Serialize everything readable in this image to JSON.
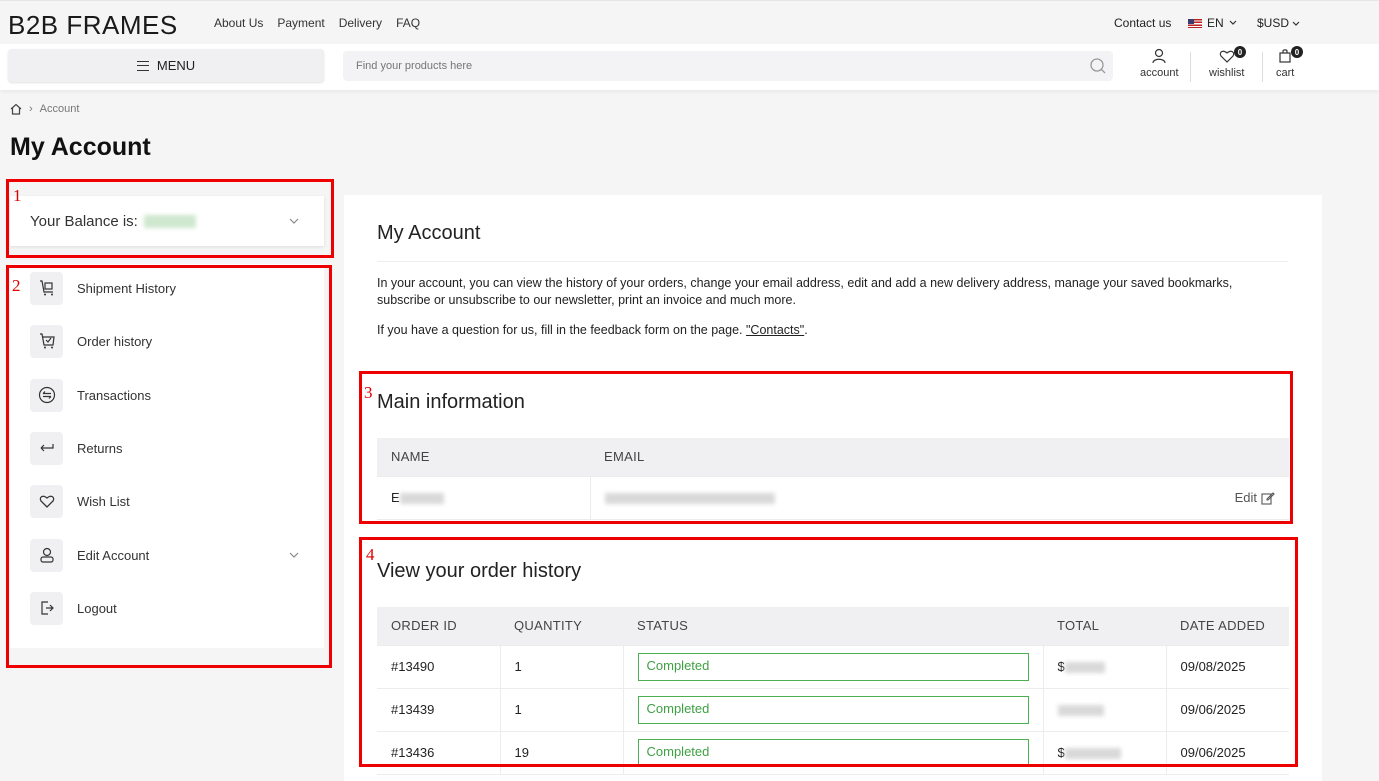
{
  "topbar": {
    "logo": "B2B FRAMES",
    "nav": [
      "About Us",
      "Payment",
      "Delivery",
      "FAQ"
    ],
    "contact": "Contact us",
    "language": "EN",
    "currency": "$USD"
  },
  "header": {
    "menu_label": "MENU",
    "search_placeholder": "Find your products here",
    "account_label": "account",
    "wishlist_label": "wishlist",
    "wishlist_count": "0",
    "cart_label": "cart",
    "cart_count": "0"
  },
  "breadcrumb": {
    "current": "Account"
  },
  "page_title": "My Account",
  "sidebar": {
    "balance_label": "Your Balance is:",
    "items": [
      {
        "label": "Shipment History",
        "icon": "cart-box-icon"
      },
      {
        "label": "Order history",
        "icon": "cart-check-icon"
      },
      {
        "label": "Transactions",
        "icon": "exchange-icon"
      },
      {
        "label": "Returns",
        "icon": "return-arrow-icon"
      },
      {
        "label": "Wish List",
        "icon": "heart-icon"
      },
      {
        "label": "Edit Account",
        "icon": "user-icon"
      },
      {
        "label": "Logout",
        "icon": "logout-icon"
      }
    ]
  },
  "main": {
    "title": "My Account",
    "intro": "In your account, you can view the history of your orders, change your email address, edit and add a new delivery address, manage your saved bookmarks, subscribe or unsubscribe to our newsletter, print an invoice and much more.",
    "question_prefix": "If you have a question for us, fill in the feedback form on the page. ",
    "contacts_link": "\"Contacts\"",
    "question_suffix": ".",
    "main_info": {
      "title": "Main information",
      "headers": [
        "NAME",
        "EMAIL"
      ],
      "name_initial": "E",
      "edit_label": "Edit"
    },
    "orders": {
      "title": "View your order history",
      "headers": [
        "ORDER ID",
        "QUANTITY",
        "STATUS",
        "TOTAL",
        "DATE ADDED"
      ],
      "rows": [
        {
          "id": "#13490",
          "qty": "1",
          "status": "Completed",
          "total_prefix": "$",
          "date": "09/08/2025"
        },
        {
          "id": "#13439",
          "qty": "1",
          "status": "Completed",
          "total_prefix": "",
          "date": "09/06/2025"
        },
        {
          "id": "#13436",
          "qty": "19",
          "status": "Completed",
          "total_prefix": "$",
          "date": "09/06/2025"
        }
      ]
    }
  },
  "annotations": [
    "1",
    "2",
    "3",
    "4"
  ],
  "colors": {
    "annotation": "#ee0000",
    "status_green": "#4caf50"
  }
}
